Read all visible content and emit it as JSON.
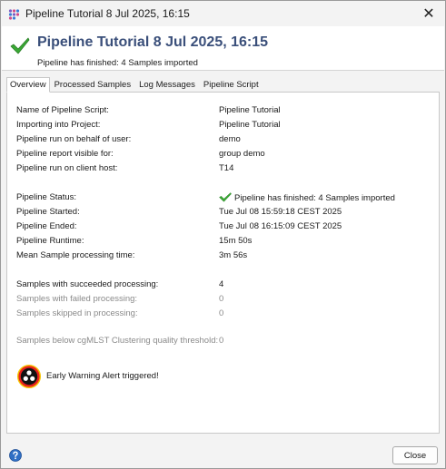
{
  "window": {
    "title": "Pipeline Tutorial 8 Jul 2025, 16:15",
    "close_glyph": "✕",
    "app_icon": "pipeline-dots-icon"
  },
  "header": {
    "title": "Pipeline Tutorial 8 Jul 2025, 16:15",
    "subtitle": "Pipeline has finished: 4 Samples imported",
    "status_icon": "green-checkmark-icon",
    "status_color": "#3aa935"
  },
  "tabs": [
    {
      "label": "Overview",
      "active": true
    },
    {
      "label": "Processed Samples",
      "active": false
    },
    {
      "label": "Log Messages",
      "active": false
    },
    {
      "label": "Pipeline Script",
      "active": false
    }
  ],
  "overview": {
    "general": [
      {
        "label": "Name of Pipeline Script:",
        "value": "Pipeline Tutorial"
      },
      {
        "label": "Importing into Project:",
        "value": "Pipeline Tutorial"
      },
      {
        "label": "Pipeline run on behalf of user:",
        "value": "demo"
      },
      {
        "label": "Pipeline report visible for:",
        "value": "group demo"
      },
      {
        "label": "Pipeline run on client host:",
        "value": "T14"
      }
    ],
    "status": [
      {
        "label": "Pipeline Status:",
        "value": "Pipeline has finished: 4 Samples imported"
      },
      {
        "label": "Pipeline Started:",
        "value": "Tue Jul 08 15:59:18 CEST 2025"
      },
      {
        "label": "Pipeline Ended:",
        "value": "Tue Jul 08 16:15:09 CEST 2025"
      },
      {
        "label": "Pipeline Runtime:",
        "value": "15m 50s"
      },
      {
        "label": "Mean Sample processing time:",
        "value": "3m 56s"
      }
    ],
    "samples": [
      {
        "label": "Samples with succeeded processing:",
        "value": "4"
      },
      {
        "label": "Samples with failed processing:",
        "value": "0"
      },
      {
        "label": "Samples skipped in processing:",
        "value": "0"
      }
    ],
    "threshold": {
      "label": "Samples below cgMLST Clustering quality threshold:",
      "value": "0"
    },
    "alert": {
      "text": "Early Warning Alert triggered!",
      "icon": "biohazard-alert-icon"
    }
  },
  "footer": {
    "help_icon": "help-question-icon",
    "close_label": "Close"
  }
}
